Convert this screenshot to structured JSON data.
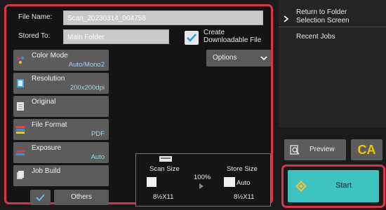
{
  "form": {
    "file_name_label": "File Name:",
    "file_name_value": "Scan_20230314_004758",
    "stored_to_label": "Stored To:",
    "stored_to_value": "Main Folder",
    "create_downloadable_line1": "Create",
    "create_downloadable_line2": "Downloadable File",
    "options_label": "Options"
  },
  "menu": [
    {
      "title": "Color Mode",
      "value": "Auto/Mono2",
      "icon": "color-mode-icon"
    },
    {
      "title": "Resolution",
      "value": "200x200dpi",
      "icon": "resolution-icon"
    },
    {
      "title": "Original",
      "value": "",
      "icon": "original-icon"
    },
    {
      "title": "File Format",
      "value": "PDF",
      "icon": "file-format-icon"
    },
    {
      "title": "Exposure",
      "value": "Auto",
      "icon": "exposure-icon"
    },
    {
      "title": "Job Build",
      "value": "",
      "icon": "job-build-icon"
    }
  ],
  "bottom": {
    "others_label": "Others"
  },
  "preview_panel": {
    "scan_size_label": "Scan Size",
    "scan_size_value": "8½X11",
    "ratio": "100%",
    "store_size_label": "Store Size",
    "store_size_auto": "Auto",
    "store_size_value": "8½X11"
  },
  "right": {
    "return_line1": "Return to Folder",
    "return_line2": "Selection Screen",
    "recent_jobs": "Recent Jobs",
    "preview_label": "Preview",
    "ca_label": "CA",
    "start_label": "Start"
  },
  "colors": {
    "highlight_border": "#d8344f",
    "start_bg": "#3fc2c2",
    "ca_text": "#f1c200",
    "value_text": "#9ed6ea"
  }
}
